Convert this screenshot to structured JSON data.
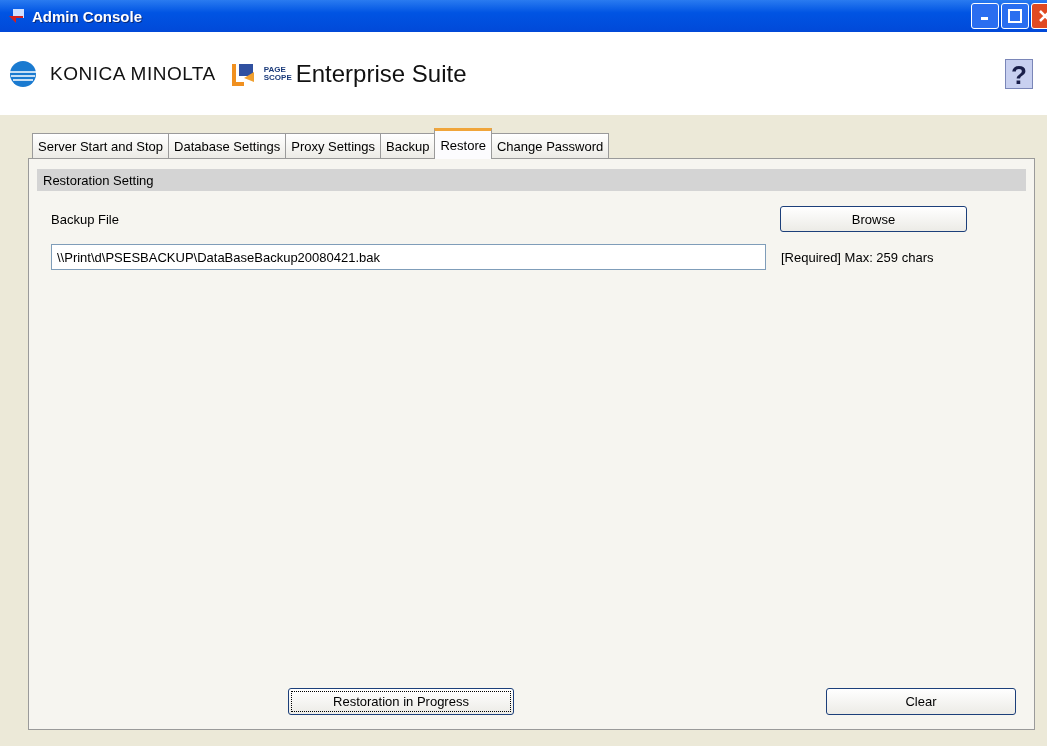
{
  "window": {
    "title": "Admin Console"
  },
  "header": {
    "brand": "KONICA MINOLTA",
    "product_small_top": "PAGE",
    "product_small_bottom": "SCOPE",
    "product": "Enterprise Suite",
    "help": "?"
  },
  "tabs": [
    {
      "label": "Server Start and Stop",
      "selected": false
    },
    {
      "label": "Database Settings",
      "selected": false
    },
    {
      "label": "Proxy Settings",
      "selected": false
    },
    {
      "label": "Backup",
      "selected": false
    },
    {
      "label": "Restore",
      "selected": true
    },
    {
      "label": "Change Password",
      "selected": false
    }
  ],
  "section": {
    "title": "Restoration Setting",
    "field_label": "Backup File",
    "browse": "Browse",
    "value": "\\\\Print\\d\\PSESBACKUP\\DataBaseBackup20080421.bak",
    "hint": "[Required] Max: 259 chars"
  },
  "buttons": [
    {
      "label": "Restoration in Progress",
      "focused": true
    },
    {
      "label": "Clear",
      "focused": false
    }
  ]
}
